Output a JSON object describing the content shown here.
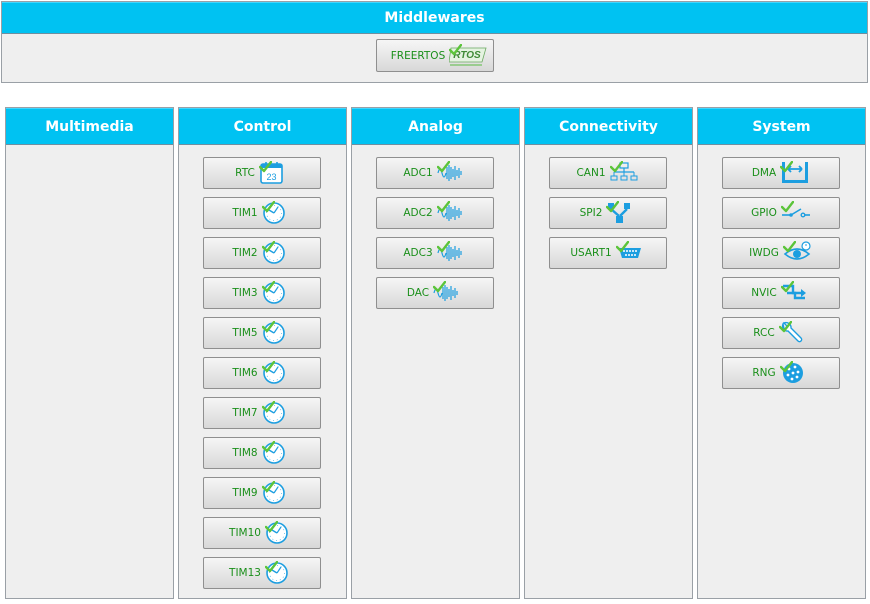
{
  "middlewares": {
    "title": "Middlewares",
    "items": [
      {
        "label": "FREERTOS",
        "icon": "rtos-logo-icon"
      }
    ]
  },
  "categories": [
    {
      "title": "Multimedia",
      "items": []
    },
    {
      "title": "Control",
      "items": [
        {
          "label": "RTC",
          "icon": "calendar-icon",
          "icon_text": "23"
        },
        {
          "label": "TIM1",
          "icon": "clock-icon"
        },
        {
          "label": "TIM2",
          "icon": "clock-icon"
        },
        {
          "label": "TIM3",
          "icon": "clock-icon"
        },
        {
          "label": "TIM5",
          "icon": "clock-icon"
        },
        {
          "label": "TIM6",
          "icon": "clock-icon"
        },
        {
          "label": "TIM7",
          "icon": "clock-icon"
        },
        {
          "label": "TIM8",
          "icon": "clock-icon"
        },
        {
          "label": "TIM9",
          "icon": "clock-icon"
        },
        {
          "label": "TIM10",
          "icon": "clock-icon"
        },
        {
          "label": "TIM13",
          "icon": "clock-icon"
        }
      ]
    },
    {
      "title": "Analog",
      "items": [
        {
          "label": "ADC1",
          "icon": "waveform-icon"
        },
        {
          "label": "ADC2",
          "icon": "waveform-icon"
        },
        {
          "label": "ADC3",
          "icon": "waveform-icon"
        },
        {
          "label": "DAC",
          "icon": "waveform-icon"
        }
      ]
    },
    {
      "title": "Connectivity",
      "items": [
        {
          "label": "CAN1",
          "icon": "network-icon"
        },
        {
          "label": "SPI2",
          "icon": "spi-bus-icon"
        },
        {
          "label": "USART1",
          "icon": "serial-port-icon"
        }
      ]
    },
    {
      "title": "System",
      "items": [
        {
          "label": "DMA",
          "icon": "dma-icon"
        },
        {
          "label": "GPIO",
          "icon": "switch-icon"
        },
        {
          "label": "IWDG",
          "icon": "eye-icon"
        },
        {
          "label": "NVIC",
          "icon": "interrupt-icon"
        },
        {
          "label": "RCC",
          "icon": "wrench-icon"
        },
        {
          "label": "RNG",
          "icon": "dice-icon"
        }
      ]
    }
  ],
  "colors": {
    "header": "#00c2f2",
    "label": "#1a8f1a",
    "icon": "#1c9ee0",
    "check": "#5cc43a"
  },
  "status_icon": "check-icon"
}
